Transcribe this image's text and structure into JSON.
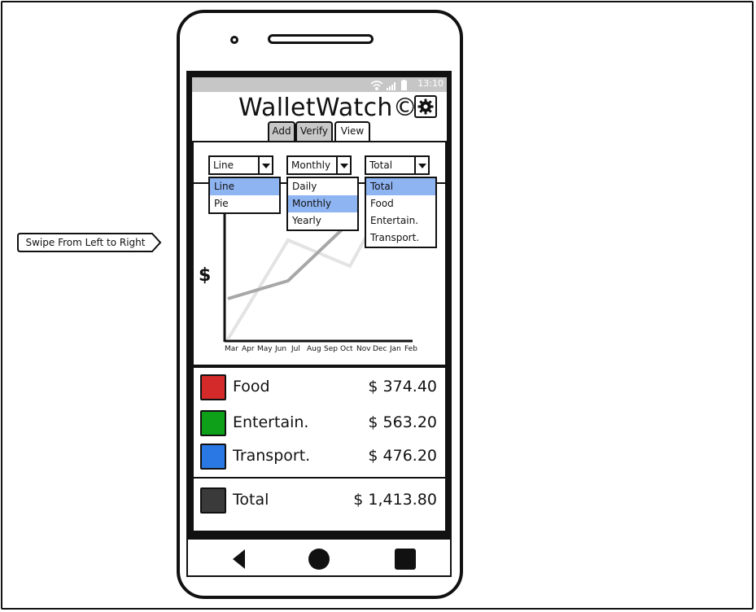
{
  "callout": {
    "label": "Swipe From Left to Right"
  },
  "status_bar": {
    "time": "13:10",
    "icons": [
      "wifi-icon",
      "signal-icon",
      "battery-icon"
    ]
  },
  "app": {
    "title": "WalletWatch©",
    "settings_icon": "gear-icon"
  },
  "tabs": [
    {
      "label": "Add",
      "active": false
    },
    {
      "label": "Verify",
      "active": false
    },
    {
      "label": "View",
      "active": true
    }
  ],
  "filters": {
    "chart_type": {
      "value": "Line",
      "options": [
        "Line",
        "Pie"
      ],
      "selected": "Line"
    },
    "period": {
      "value": "Monthly",
      "options": [
        "Daily",
        "Monthly",
        "Yearly"
      ],
      "selected": "Monthly"
    },
    "category": {
      "value": "Total",
      "options": [
        "Total",
        "Food",
        "Entertain.",
        "Transport."
      ],
      "selected": "Total"
    }
  },
  "chart_data": {
    "type": "line",
    "ylabel": "$",
    "categories": [
      "Mar",
      "Apr",
      "May",
      "Jun",
      "Jul",
      "Aug",
      "Sep",
      "Oct",
      "Nov",
      "Dec",
      "Jan",
      "Feb"
    ]
  },
  "summary": {
    "items": [
      {
        "label": "Food",
        "value": "$ 374.40",
        "color": "#d42a2a"
      },
      {
        "label": "Entertain.",
        "value": "$ 563.20",
        "color": "#0fa01a"
      },
      {
        "label": "Transport.",
        "value": "$ 476.20",
        "color": "#2a78e4"
      }
    ],
    "total": {
      "label": "Total",
      "value": "$ 1,413.80",
      "color": "#3a3a3a"
    }
  },
  "nav": {
    "back_icon": "back-icon",
    "home_icon": "home-icon",
    "recents_icon": "recents-icon"
  },
  "colors": {
    "selected_option": "#8fb4f2",
    "statusbar": "#c6c6c6",
    "tab_inactive": "#c8c8c8"
  }
}
